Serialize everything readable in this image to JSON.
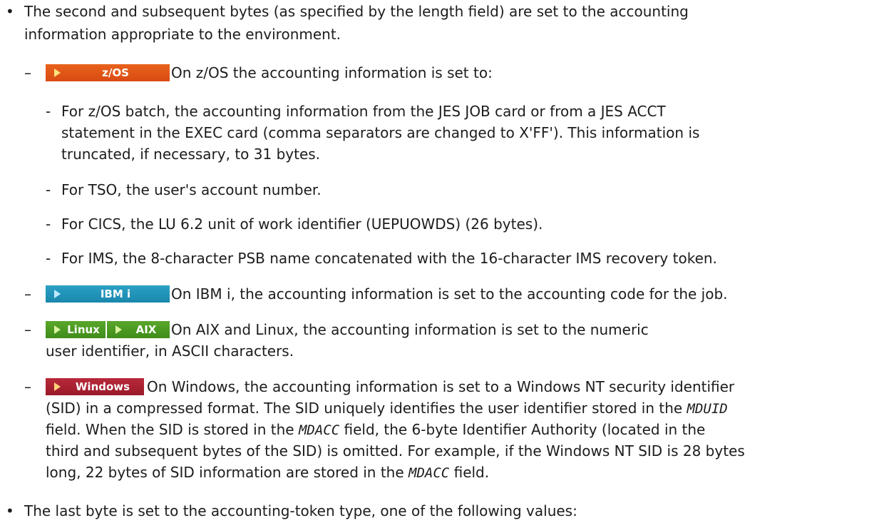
{
  "bullet_glyph": "•",
  "dash_glyph": "–",
  "hyphen_glyph": "-",
  "para1": {
    "line1": "The second and subsequent bytes (as specified by the length field) are set to the accounting",
    "line2": "information appropriate to the environment."
  },
  "zos": {
    "badge": "z/OS",
    "intro": "On z/OS the accounting information is set to:",
    "items": [
      {
        "line1": "For z/OS batch, the accounting information from the JES JOB card or from a JES ACCT",
        "line2": "statement in the EXEC card (comma separators are changed to X'FF'). This information is",
        "line3": "truncated, if necessary, to 31 bytes."
      },
      {
        "line1": "For TSO, the user's account number."
      },
      {
        "line1": "For CICS, the LU 6.2 unit of work identifier (UEPUOWDS) (26 bytes)."
      },
      {
        "line1": "For IMS, the 8-character PSB name concatenated with the 16-character IMS recovery token."
      }
    ]
  },
  "ibmi": {
    "badge": "IBM i",
    "text": "On IBM i, the accounting information is set to the accounting code for the job."
  },
  "unix": {
    "badge_linux": "Linux",
    "badge_aix": "AIX",
    "line1": "On AIX and Linux, the accounting information is set to the numeric",
    "line2": "user identifier, in ASCII characters."
  },
  "windows": {
    "badge": "Windows",
    "line1": "On Windows, the accounting information is set to a Windows NT security identifier",
    "line2": "(SID) in a compressed format. The SID uniquely identifies the user identifier stored in the",
    "field1": "MDUID",
    "line3_post": "field. When the SID is stored in the",
    "field2": "MDACC",
    "line3_tail": "field, the 6-byte Identifier Authority (located in the",
    "line4": "third and subsequent bytes of the SID) is omitted. For example, if the Windows NT SID is 28 bytes",
    "line5_pre": "long, 22 bytes of SID information are stored in the",
    "field3": "MDACC",
    "line5_post": "field."
  },
  "para2": {
    "line1": "The last byte is set to the accounting-token type, one of the following values:"
  },
  "colors": {
    "zos": "#e05a18",
    "ibmi": "#2399bf",
    "linux": "#4e9c24",
    "aix": "#4e9c24",
    "windows": "#ab2233",
    "text": "#1c1c1c"
  }
}
